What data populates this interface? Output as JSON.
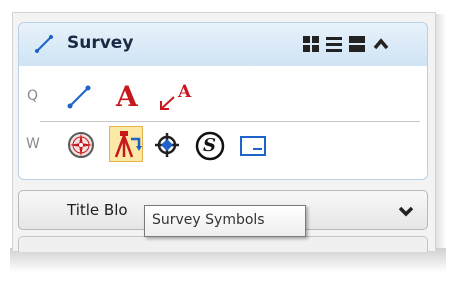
{
  "panel": {
    "title": "Survey",
    "header_icon": "survey-line-icon",
    "header_controls": [
      "grid-view-icon",
      "list-view-icon",
      "panel-view-icon",
      "collapse-up-icon"
    ]
  },
  "rows": [
    {
      "key": "Q",
      "tools": [
        {
          "icon": "survey-line-icon"
        },
        {
          "icon": "text-icon",
          "text": "A"
        },
        {
          "icon": "text-leader-icon",
          "text": "A"
        }
      ]
    },
    {
      "key": "W",
      "tools": [
        {
          "icon": "compass-rose-icon"
        },
        {
          "icon": "survey-symbols-icon",
          "selected": true
        },
        {
          "icon": "crosshair-icon"
        },
        {
          "icon": "survey-s-symbol-icon",
          "text": "S"
        },
        {
          "icon": "rectangle-icon"
        }
      ]
    }
  ],
  "collapsed_section": {
    "label": "Title Blo",
    "icon": "chevron-down-icon"
  },
  "tooltip": {
    "text": "Survey Symbols"
  },
  "colors": {
    "header_bg": "#cfe3f4",
    "accent_red": "#c8181e",
    "accent_blue": "#1d63c9",
    "selected_bg": "#fde9a6"
  }
}
